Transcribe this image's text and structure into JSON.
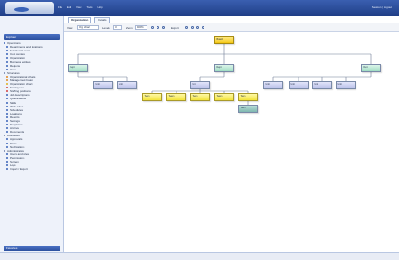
{
  "app": {
    "logo_text": "",
    "menu": [
      "File",
      "Edit",
      "View",
      "Tools",
      "Help"
    ],
    "user_info": "Session | Logout"
  },
  "sidebar": {
    "title": "Explorer",
    "items": [
      {
        "label": "Operations",
        "color": "#3a64b8"
      },
      {
        "label": "Departments and locations",
        "color": "#3a64b8"
      },
      {
        "label": "Functional areas",
        "color": "#3a64b8"
      },
      {
        "label": "Cost centers",
        "color": "#3a64b8"
      },
      {
        "label": "Organization",
        "color": "#3a64b8"
      },
      {
        "label": "Business entities",
        "color": "#3a64b8"
      },
      {
        "label": "Regions",
        "color": "#3a64b8"
      },
      {
        "label": "Units",
        "color": "#3a64b8"
      },
      {
        "label": "Structures",
        "color": "#6b7fa8"
      },
      {
        "label": "Organizational charts",
        "color": "#e08a1e"
      },
      {
        "label": "Management board",
        "color": "#e08a1e"
      },
      {
        "label": "Organization chart",
        "color": "#e0b020"
      },
      {
        "label": "Employees",
        "color": "#d04040"
      },
      {
        "label": "Staffing positions",
        "color": "#d04040"
      },
      {
        "label": "Job descriptions",
        "color": "#3a64b8"
      },
      {
        "label": "Qualifications",
        "color": "#3a64b8"
      },
      {
        "label": "Skills",
        "color": "#3a64b8"
      },
      {
        "label": "Work rules",
        "color": "#3a64b8"
      },
      {
        "label": "Schedules",
        "color": "#3a64b8"
      },
      {
        "label": "Locations",
        "color": "#3a64b8"
      },
      {
        "label": "Reports",
        "color": "#3a64b8"
      },
      {
        "label": "Settings",
        "color": "#3a64b8"
      },
      {
        "label": "Templates",
        "color": "#3a64b8"
      },
      {
        "label": "Archive",
        "color": "#3a64b8"
      },
      {
        "label": "Documents",
        "color": "#3a64b8"
      },
      {
        "label": "Workflows",
        "color": "#6b7fa8"
      },
      {
        "label": "Approvals",
        "color": "#3a64b8"
      },
      {
        "label": "Tasks",
        "color": "#3a64b8"
      },
      {
        "label": "Notifications",
        "color": "#3a64b8"
      },
      {
        "label": "Administration",
        "color": "#6b7fa8"
      },
      {
        "label": "Users and roles",
        "color": "#3a64b8"
      },
      {
        "label": "Permissions",
        "color": "#3a64b8"
      },
      {
        "label": "System",
        "color": "#3a64b8"
      },
      {
        "label": "Logs",
        "color": "#3a64b8"
      },
      {
        "label": "Import / Export",
        "color": "#3a64b8"
      }
    ],
    "bottom_title": "Favorites"
  },
  "main": {
    "tabs": [
      {
        "label": "Organization",
        "active": true
      },
      {
        "label": "Details",
        "active": false
      }
    ],
    "toolbar": {
      "view_label": "View",
      "view_value": "Org chart",
      "level_label": "Levels",
      "level_value": "3",
      "zoom_label": "Zoom",
      "zoom_value": "100%",
      "export_label": "Export"
    },
    "chart": {
      "root": {
        "line1": "Board",
        "line2": ""
      },
      "level1": [
        {
          "line1": "Dept",
          "line2": "",
          "color": "green"
        },
        {
          "line1": "Dept",
          "line2": "",
          "color": "green"
        },
        {
          "line1": "Dept",
          "line2": "",
          "color": "green"
        }
      ],
      "level2": [
        {
          "line1": "Unit",
          "line2": "",
          "color": "purple"
        },
        {
          "line1": "Unit",
          "line2": "",
          "color": "purple"
        },
        {
          "line1": "Unit",
          "line2": "",
          "color": "purple"
        },
        {
          "line1": "Unit",
          "line2": "",
          "color": "purple"
        },
        {
          "line1": "Unit",
          "line2": "",
          "color": "purple"
        },
        {
          "line1": "Unit",
          "line2": "",
          "color": "purple"
        },
        {
          "line1": "Unit",
          "line2": "",
          "color": "purple"
        }
      ],
      "level3": [
        {
          "line1": "Team",
          "line2": "",
          "color": "yellow"
        },
        {
          "line1": "Team",
          "line2": "",
          "color": "yellow"
        },
        {
          "line1": "Team",
          "line2": "",
          "color": "yellow"
        },
        {
          "line1": "Team",
          "line2": "",
          "color": "yellow"
        },
        {
          "line1": "Team",
          "line2": "",
          "color": "yellow"
        },
        {
          "line1": "Team",
          "line2": "",
          "color": "teal"
        }
      ]
    }
  }
}
